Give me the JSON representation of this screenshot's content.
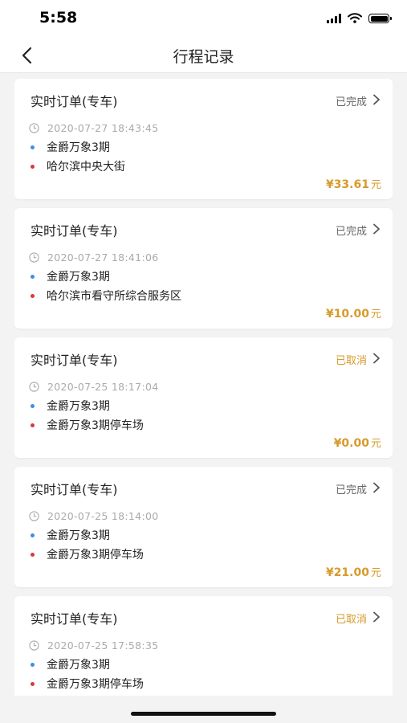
{
  "status_bar": {
    "time": "5:58"
  },
  "nav": {
    "title": "行程记录",
    "back_icon": "chevron-left-icon"
  },
  "trips": [
    {
      "title": "实时订单(专车)",
      "status": "已完成",
      "status_type": "done",
      "time": "2020-07-27 18:43:45",
      "from": "金爵万象3期",
      "to": "哈尔滨中央大街",
      "price": "¥33.61",
      "unit": "元"
    },
    {
      "title": "实时订单(专车)",
      "status": "已完成",
      "status_type": "done",
      "time": "2020-07-27 18:41:06",
      "from": "金爵万象3期",
      "to": "哈尔滨市看守所综合服务区",
      "price": "¥10.00",
      "unit": "元"
    },
    {
      "title": "实时订单(专车)",
      "status": "已取消",
      "status_type": "cancel",
      "time": "2020-07-25 18:17:04",
      "from": "金爵万象3期",
      "to": "金爵万象3期停车场",
      "price": "¥0.00",
      "unit": "元"
    },
    {
      "title": "实时订单(专车)",
      "status": "已完成",
      "status_type": "done",
      "time": "2020-07-25 18:14:00",
      "from": "金爵万象3期",
      "to": "金爵万象3期停车场",
      "price": "¥21.00",
      "unit": "元"
    },
    {
      "title": "实时订单(专车)",
      "status": "已取消",
      "status_type": "cancel",
      "time": "2020-07-25 17:58:35",
      "from": "金爵万象3期",
      "to": "金爵万象3期停车场",
      "price": "",
      "unit": ""
    }
  ],
  "colors": {
    "accent": "#d79a2b",
    "origin_dot": "#3d8ee6",
    "destination_dot": "#d93a3a",
    "background": "#f3f3f3"
  }
}
